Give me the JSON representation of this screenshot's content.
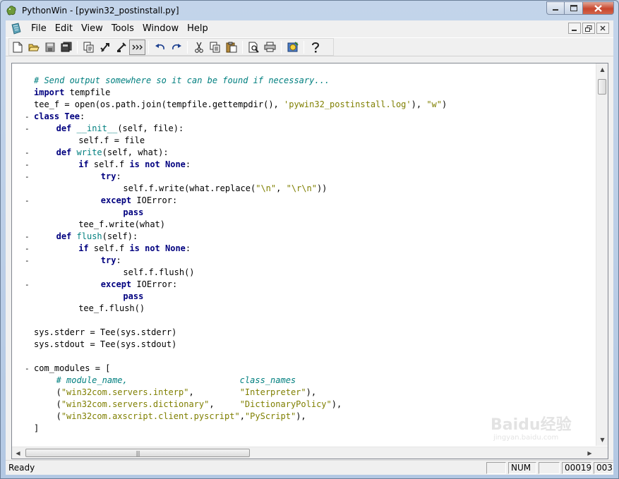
{
  "window": {
    "title": "PythonWin - [pywin32_postinstall.py]"
  },
  "menu": {
    "items": [
      "File",
      "Edit",
      "View",
      "Tools",
      "Window",
      "Help"
    ]
  },
  "toolbar": {
    "icons": [
      "new-file-icon",
      "open-folder-icon",
      "save-icon",
      "save-all-icon",
      "check-icon",
      "run-icon",
      "import-icon",
      "whitespace-icon",
      "undo-icon",
      "redo-icon",
      "cut-icon",
      "copy-icon",
      "paste-icon",
      "print-preview-icon",
      "print-icon",
      "debug-icon",
      "help-icon"
    ]
  },
  "editor": {
    "lines": [
      {
        "fold": "",
        "indent": 0,
        "tokens": [
          {
            "t": "# Send output somewhere so it can be found if necessary...",
            "c": "cm"
          }
        ]
      },
      {
        "fold": "",
        "indent": 0,
        "tokens": [
          {
            "t": "import",
            "c": "kw"
          },
          {
            "t": " tempfile",
            "c": ""
          }
        ]
      },
      {
        "fold": "",
        "indent": 0,
        "tokens": [
          {
            "t": "tee_f = open(os.path.join(tempfile.gettempdir(), ",
            "c": ""
          },
          {
            "t": "'pywin32_postinstall.log'",
            "c": "st"
          },
          {
            "t": "), ",
            "c": ""
          },
          {
            "t": "\"w\"",
            "c": "st"
          },
          {
            "t": ")",
            "c": ""
          }
        ]
      },
      {
        "fold": "-",
        "indent": 0,
        "tokens": [
          {
            "t": "class",
            "c": "kw"
          },
          {
            "t": " ",
            "c": ""
          },
          {
            "t": "Tee",
            "c": "kw"
          },
          {
            "t": ":",
            "c": ""
          }
        ]
      },
      {
        "fold": "-",
        "indent": 4,
        "tokens": [
          {
            "t": "def",
            "c": "kw"
          },
          {
            "t": " ",
            "c": ""
          },
          {
            "t": "__init__",
            "c": "fn"
          },
          {
            "t": "(self, file):",
            "c": ""
          }
        ]
      },
      {
        "fold": "",
        "indent": 8,
        "tokens": [
          {
            "t": "self.f = file",
            "c": ""
          }
        ]
      },
      {
        "fold": "-",
        "indent": 4,
        "tokens": [
          {
            "t": "def",
            "c": "kw"
          },
          {
            "t": " ",
            "c": ""
          },
          {
            "t": "write",
            "c": "fn"
          },
          {
            "t": "(self, what):",
            "c": ""
          }
        ]
      },
      {
        "fold": "-",
        "indent": 8,
        "tokens": [
          {
            "t": "if",
            "c": "kw"
          },
          {
            "t": " self.f ",
            "c": ""
          },
          {
            "t": "is not None",
            "c": "kw"
          },
          {
            "t": ":",
            "c": ""
          }
        ]
      },
      {
        "fold": "-",
        "indent": 12,
        "tokens": [
          {
            "t": "try",
            "c": "kw"
          },
          {
            "t": ":",
            "c": ""
          }
        ]
      },
      {
        "fold": "",
        "indent": 16,
        "tokens": [
          {
            "t": "self.f.write(what.replace(",
            "c": ""
          },
          {
            "t": "\"\\n\"",
            "c": "st"
          },
          {
            "t": ", ",
            "c": ""
          },
          {
            "t": "\"\\r\\n\"",
            "c": "st"
          },
          {
            "t": "))",
            "c": ""
          }
        ]
      },
      {
        "fold": "-",
        "indent": 12,
        "tokens": [
          {
            "t": "except",
            "c": "kw"
          },
          {
            "t": " IOError:",
            "c": ""
          }
        ]
      },
      {
        "fold": "",
        "indent": 16,
        "tokens": [
          {
            "t": "pass",
            "c": "kw"
          }
        ]
      },
      {
        "fold": "",
        "indent": 8,
        "tokens": [
          {
            "t": "tee_f.write(what)",
            "c": ""
          }
        ]
      },
      {
        "fold": "-",
        "indent": 4,
        "tokens": [
          {
            "t": "def",
            "c": "kw"
          },
          {
            "t": " ",
            "c": ""
          },
          {
            "t": "flush",
            "c": "fn"
          },
          {
            "t": "(self):",
            "c": ""
          }
        ]
      },
      {
        "fold": "-",
        "indent": 8,
        "tokens": [
          {
            "t": "if",
            "c": "kw"
          },
          {
            "t": " self.f ",
            "c": ""
          },
          {
            "t": "is not None",
            "c": "kw"
          },
          {
            "t": ":",
            "c": ""
          }
        ]
      },
      {
        "fold": "-",
        "indent": 12,
        "tokens": [
          {
            "t": "try",
            "c": "kw"
          },
          {
            "t": ":",
            "c": ""
          }
        ]
      },
      {
        "fold": "",
        "indent": 16,
        "tokens": [
          {
            "t": "self.f.flush()",
            "c": ""
          }
        ]
      },
      {
        "fold": "-",
        "indent": 12,
        "tokens": [
          {
            "t": "except",
            "c": "kw"
          },
          {
            "t": " IOError:",
            "c": ""
          }
        ]
      },
      {
        "fold": "",
        "indent": 16,
        "tokens": [
          {
            "t": "pass",
            "c": "kw"
          }
        ]
      },
      {
        "fold": "",
        "indent": 8,
        "tokens": [
          {
            "t": "tee_f.flush()",
            "c": ""
          }
        ]
      },
      {
        "fold": "",
        "indent": 0,
        "tokens": []
      },
      {
        "fold": "",
        "indent": 0,
        "tokens": [
          {
            "t": "sys.stderr = Tee(sys.stderr)",
            "c": ""
          }
        ]
      },
      {
        "fold": "",
        "indent": 0,
        "tokens": [
          {
            "t": "sys.stdout = Tee(sys.stdout)",
            "c": ""
          }
        ]
      },
      {
        "fold": "",
        "indent": 0,
        "tokens": []
      },
      {
        "fold": "-",
        "indent": 0,
        "tokens": [
          {
            "t": "com_modules = [",
            "c": ""
          }
        ]
      },
      {
        "fold": "",
        "indent": 4,
        "tokens": [
          {
            "t": "# module_name,                      class_names",
            "c": "cm"
          }
        ]
      },
      {
        "fold": "",
        "indent": 4,
        "tokens": [
          {
            "t": "(",
            "c": ""
          },
          {
            "t": "\"win32com.servers.interp\"",
            "c": "st"
          },
          {
            "t": ",         ",
            "c": ""
          },
          {
            "t": "\"Interpreter\"",
            "c": "st"
          },
          {
            "t": "),",
            "c": ""
          }
        ]
      },
      {
        "fold": "",
        "indent": 4,
        "tokens": [
          {
            "t": "(",
            "c": ""
          },
          {
            "t": "\"win32com.servers.dictionary\"",
            "c": "st"
          },
          {
            "t": ",     ",
            "c": ""
          },
          {
            "t": "\"DictionaryPolicy\"",
            "c": "st"
          },
          {
            "t": "),",
            "c": ""
          }
        ]
      },
      {
        "fold": "",
        "indent": 4,
        "tokens": [
          {
            "t": "(",
            "c": ""
          },
          {
            "t": "\"win32com.axscript.client.pyscript\"",
            "c": "st"
          },
          {
            "t": ",",
            "c": ""
          },
          {
            "t": "\"PyScript\"",
            "c": "st"
          },
          {
            "t": "),",
            "c": ""
          }
        ]
      },
      {
        "fold": "",
        "indent": 0,
        "tokens": [
          {
            "t": "]",
            "c": ""
          }
        ]
      }
    ]
  },
  "status": {
    "text": "Ready",
    "num": "NUM",
    "line": "00019",
    "col": "003"
  },
  "watermark": {
    "text": "Baidu经验",
    "sub": "jingyan.baidu.com"
  }
}
